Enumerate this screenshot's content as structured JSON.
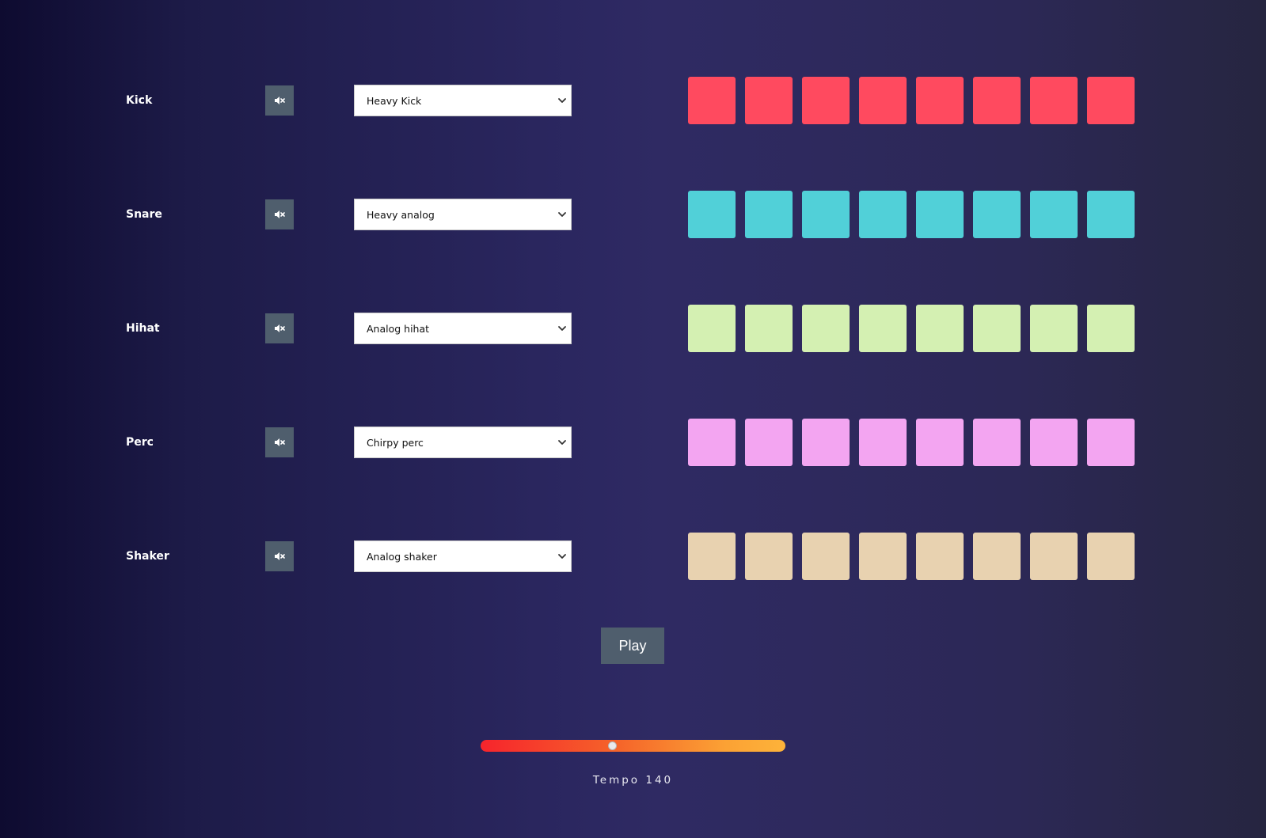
{
  "tracks": [
    {
      "name": "Kick",
      "sound": "Heavy Kick",
      "pad_color": "#ff4a5f",
      "steps": 8
    },
    {
      "name": "Snare",
      "sound": "Heavy analog",
      "pad_color": "#51d0d8",
      "steps": 8
    },
    {
      "name": "Hihat",
      "sound": "Analog hihat",
      "pad_color": "#d4f0b2",
      "steps": 8
    },
    {
      "name": "Perc",
      "sound": "Chirpy perc",
      "pad_color": "#f3a5f1",
      "steps": 8
    },
    {
      "name": "Shaker",
      "sound": "Analog shaker",
      "pad_color": "#e8d2b0",
      "steps": 8
    }
  ],
  "icons": {
    "mute": "speaker-muted-icon",
    "select": "chevron-down-icon"
  },
  "colors": {
    "mute_button": "#4f5e6d",
    "play_button": "#4f5e6d"
  },
  "play": {
    "label": "Play"
  },
  "tempo": {
    "label": "Tempo",
    "value": "140",
    "slider_fraction": 0.43
  }
}
